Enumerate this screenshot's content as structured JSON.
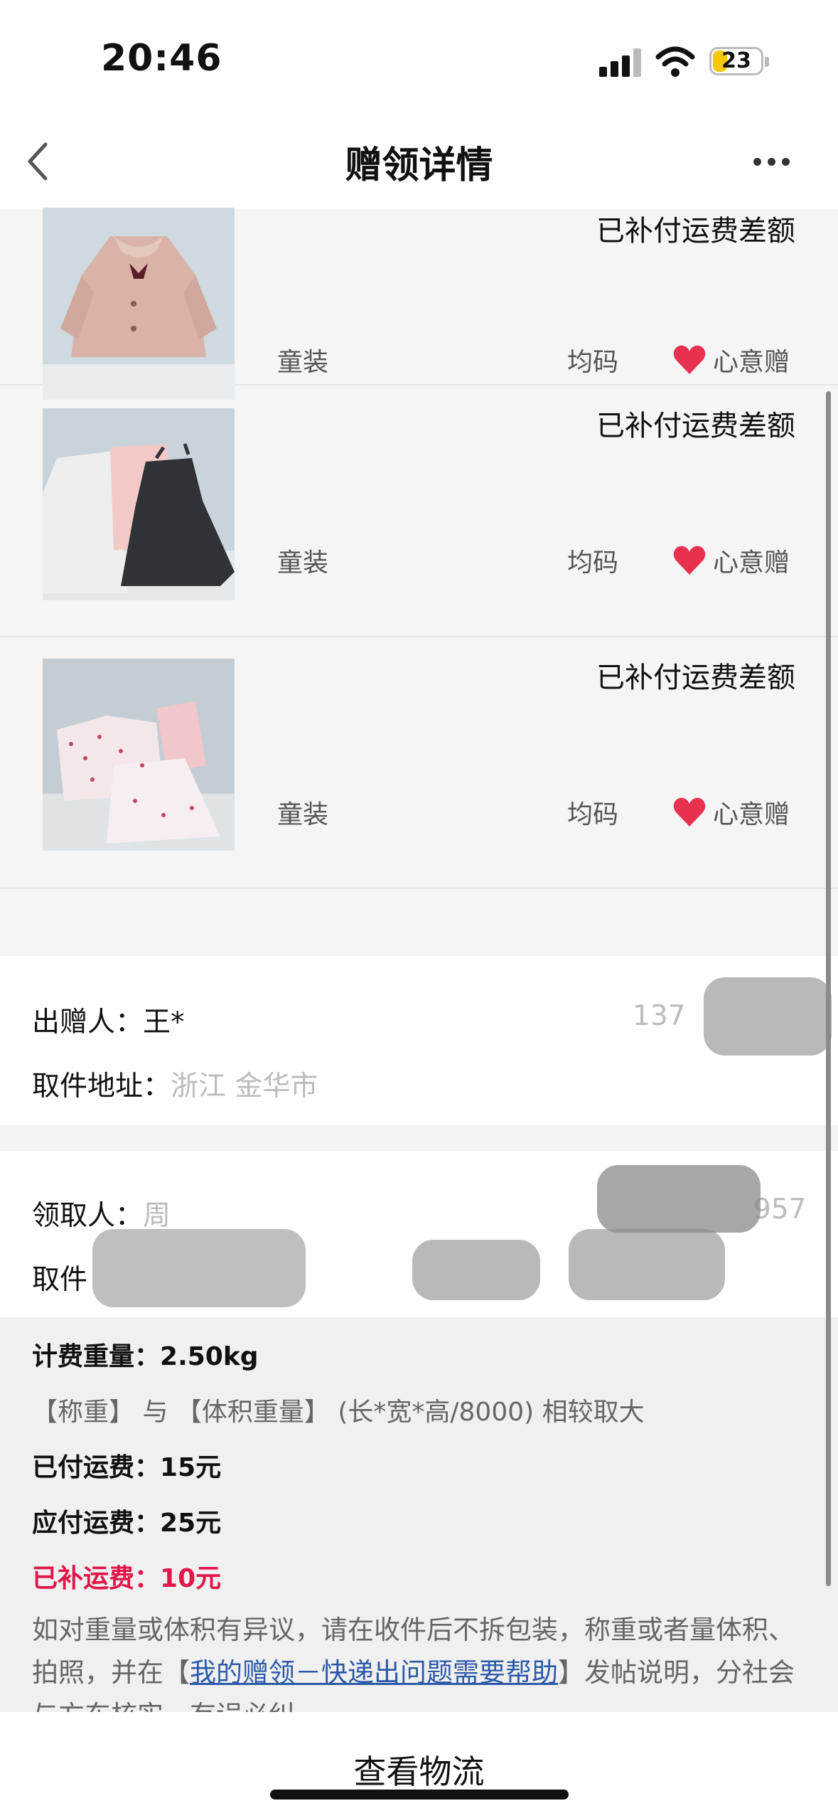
{
  "status_bar": {
    "time": "20:46",
    "battery_level": "23",
    "battery_color": "#f5c800"
  },
  "header": {
    "title": "赠领详情"
  },
  "items": [
    {
      "status": "已补付运费差额",
      "category": "童装",
      "size": "均码",
      "gift_label": "心意赠",
      "image": "pink-wool-coat-photo"
    },
    {
      "status": "已补付运费差额",
      "category": "童装",
      "size": "均码",
      "gift_label": "心意赠",
      "image": "dresses-photo"
    },
    {
      "status": "已补付运费差额",
      "category": "童装",
      "size": "均码",
      "gift_label": "心意赠",
      "image": "floral-clothes-photo"
    }
  ],
  "donor": {
    "name_label": "出赠人：",
    "name_value": "王*",
    "phone_partial": "137",
    "address_label": "取件地址：",
    "address_partial": "浙江 金华市"
  },
  "receiver": {
    "name_label": "领取人：",
    "name_partial": "周",
    "phone_partial": "957",
    "address_label": "取件"
  },
  "weight": {
    "billing_label": "计费重量：",
    "billing_value": "2.50kg",
    "note": "【称重】 与 【体积重量】 (长*宽*高/8000) 相较取大",
    "paid_label": "已付运费：",
    "paid_value": "15元",
    "due_label": "应付运费：",
    "due_value": "25元",
    "supplement_label": "已补运费：",
    "supplement_value": "10元",
    "help_part1": "如对重量或体积有异议，请在收件后不拆包装，称重或者量体积、拍照，并在【",
    "help_link": "我的赠领－快递出问题需要帮助",
    "help_part2": "】发帖说明，分社会与方东核实，有误必纠。",
    "accent_color": "#e0174a"
  },
  "bottom": {
    "button_label": "查看物流"
  }
}
